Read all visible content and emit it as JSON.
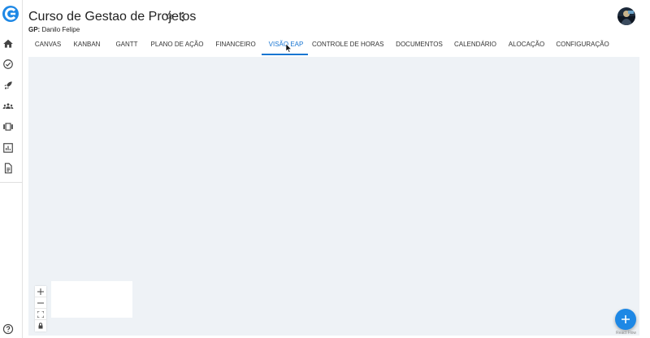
{
  "project": {
    "title": "Curso de Gestao de Projetos",
    "gp_label": "GP:",
    "gp_name": "Danilo Felipe"
  },
  "tabs": [
    {
      "label": "CANVAS"
    },
    {
      "label": "KANBAN"
    },
    {
      "label": "GANTT"
    },
    {
      "label": "PLANO DE AÇÃO"
    },
    {
      "label": "FINANCEIRO"
    },
    {
      "label": "VISÃO EAP",
      "active": true
    },
    {
      "label": "CONTROLE DE HORAS"
    },
    {
      "label": "DOCUMENTOS"
    },
    {
      "label": "CALENDÁRIO"
    },
    {
      "label": "ALOCAÇÃO"
    },
    {
      "label": "CONFIGURAÇÃO"
    }
  ],
  "sidebar": {
    "icons": [
      "home-icon",
      "check-circle-icon",
      "rocket-icon",
      "groups-icon",
      "view-carousel-icon",
      "bar-chart-icon",
      "document-icon"
    ],
    "help_icon": "help-icon"
  },
  "flow": {
    "controls": [
      "zoom-in",
      "zoom-out",
      "fit-view",
      "lock"
    ],
    "attribution": "React Flow",
    "fab_icon": "plus-icon"
  },
  "colors": {
    "accent": "#1976d2",
    "canvas_bg": "#eef2f6",
    "fab": "#1e88e5"
  }
}
